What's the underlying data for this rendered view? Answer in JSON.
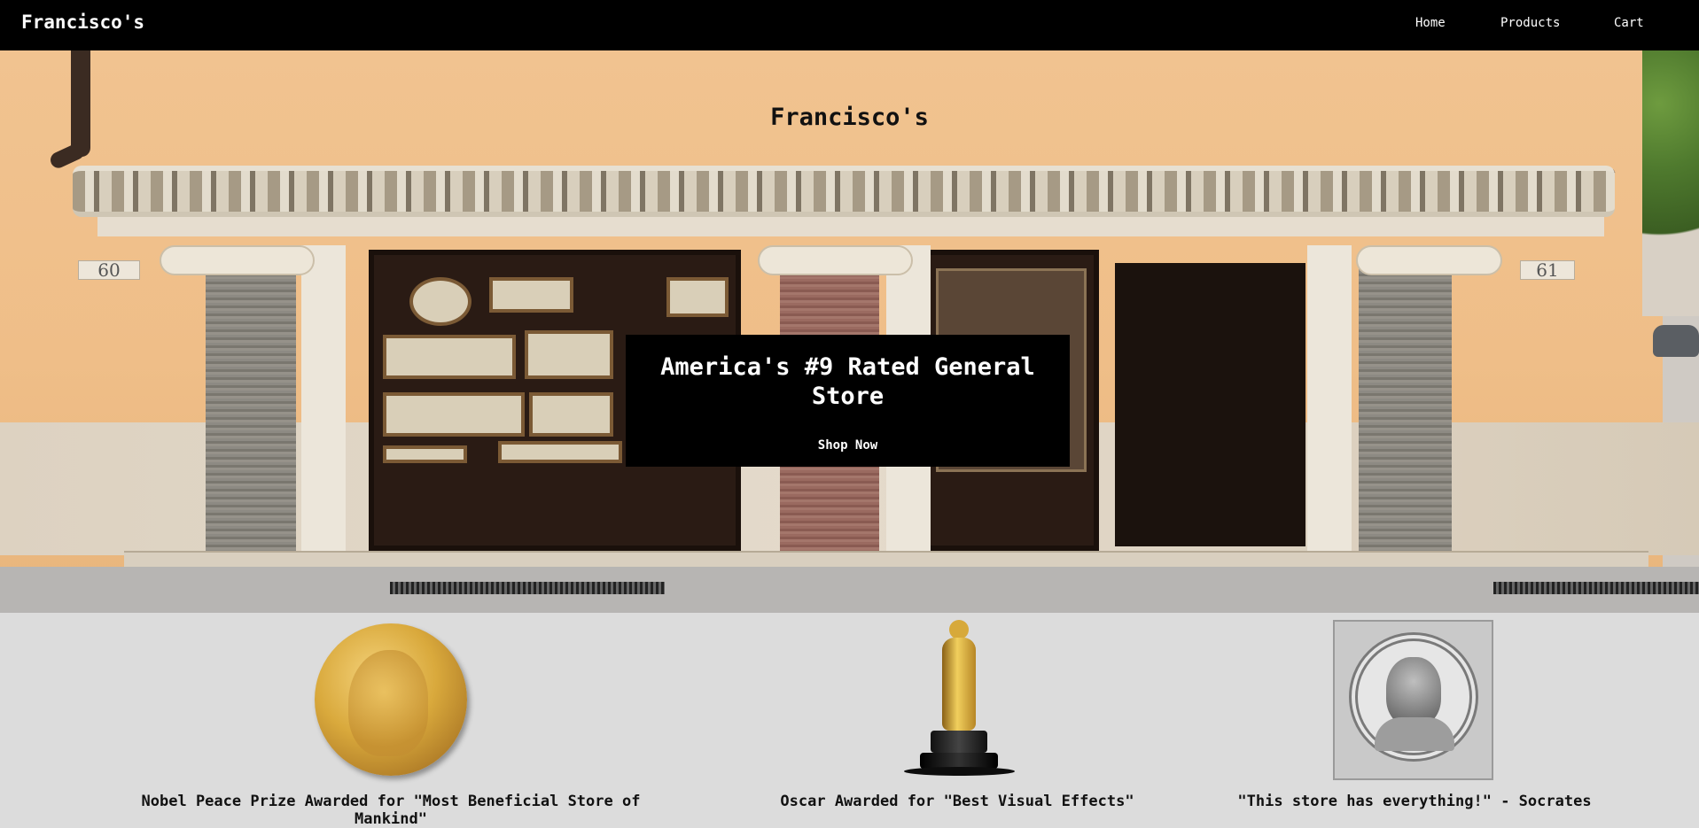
{
  "navbar": {
    "brand": "Francisco's",
    "links": [
      "Home",
      "Products",
      "Cart"
    ]
  },
  "hero": {
    "title": "Francisco's",
    "headline": "America's #9 Rated General Store",
    "cta_label": "Shop Now",
    "building_numbers": [
      "60",
      "61"
    ]
  },
  "awards": [
    {
      "icon": "nobel-medal-icon",
      "caption": "Nobel Peace Prize Awarded for \"Most Beneficial Store of Mankind\""
    },
    {
      "icon": "oscar-statuette-icon",
      "caption": "Oscar Awarded for \"Best Visual Effects\""
    },
    {
      "icon": "socrates-portrait-icon",
      "caption": "\"This store has everything!\" - Socrates"
    }
  ],
  "colors": {
    "navbar_bg": "#000000",
    "awards_bg": "#dcdcdc",
    "cta_bg": "#000000",
    "text_light": "#ffffff"
  }
}
